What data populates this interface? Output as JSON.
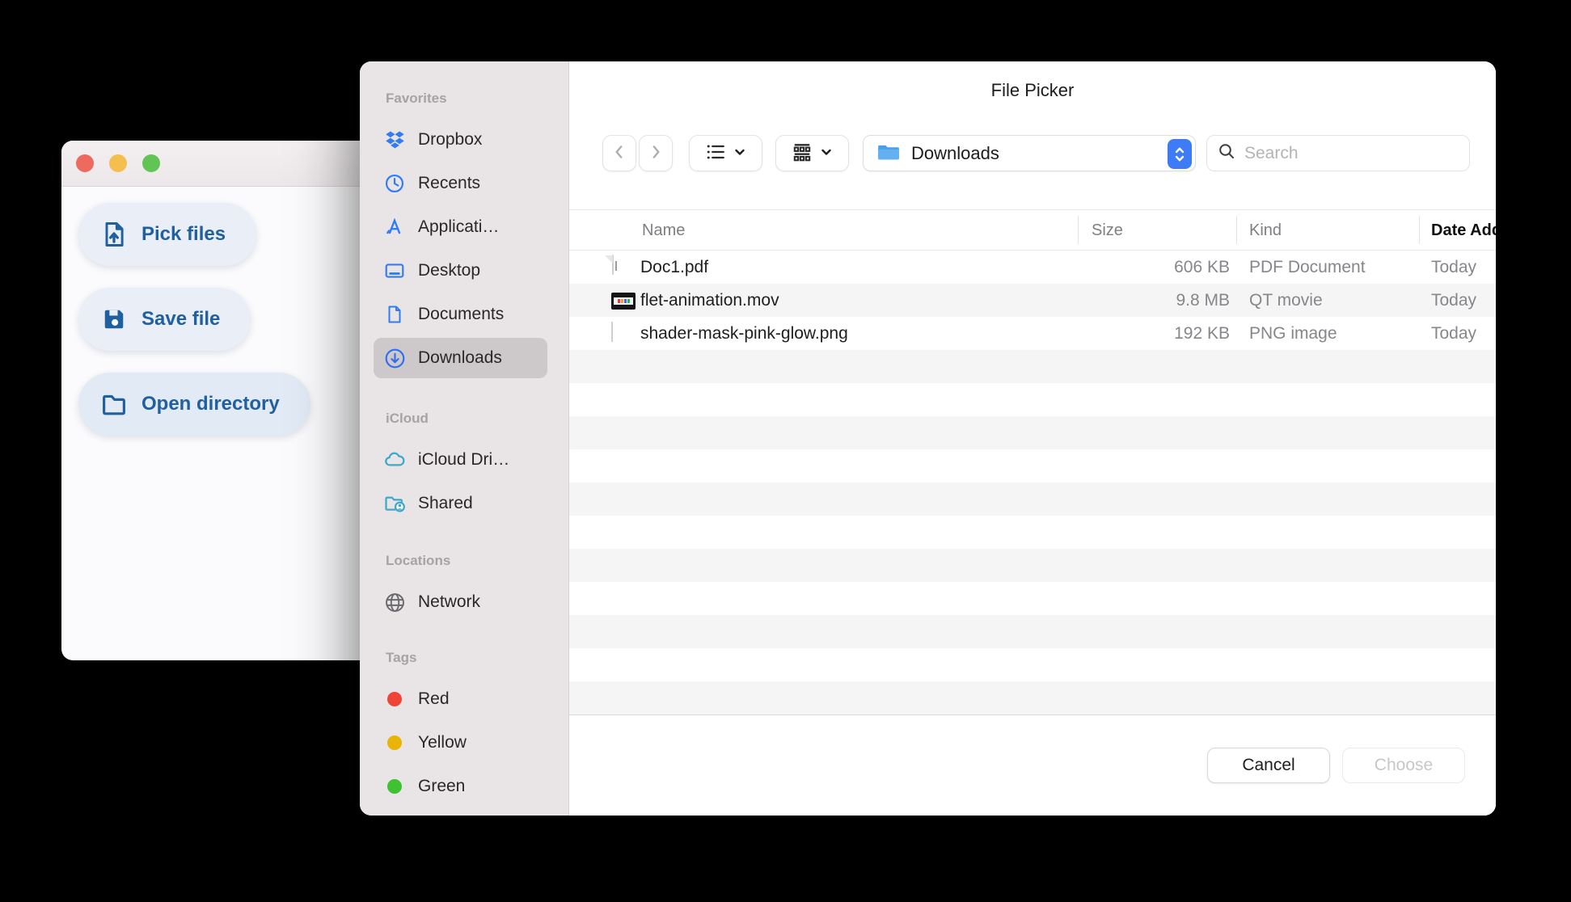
{
  "app_window": {
    "window_controls": [
      "close",
      "minimize",
      "zoom"
    ],
    "buttons": [
      {
        "label": "Pick files",
        "icon": "file-upload-icon"
      },
      {
        "label": "Save file",
        "icon": "save-icon"
      },
      {
        "label": "Open directory",
        "icon": "folder-open-icon"
      }
    ]
  },
  "dialog": {
    "title": "File Picker",
    "sidebar": {
      "sections": [
        {
          "label": "Favorites",
          "items": [
            {
              "label": "Dropbox",
              "icon": "dropbox-icon"
            },
            {
              "label": "Recents",
              "icon": "clock-icon"
            },
            {
              "label": "Applicati…",
              "icon": "app-store-icon"
            },
            {
              "label": "Desktop",
              "icon": "desktop-icon"
            },
            {
              "label": "Documents",
              "icon": "document-icon"
            },
            {
              "label": "Downloads",
              "icon": "download-circle-icon",
              "selected": true
            }
          ]
        },
        {
          "label": "iCloud",
          "items": [
            {
              "label": "iCloud Dri…",
              "icon": "cloud-icon"
            },
            {
              "label": "Shared",
              "icon": "shared-folder-icon"
            }
          ]
        },
        {
          "label": "Locations",
          "items": [
            {
              "label": "Network",
              "icon": "globe-icon"
            }
          ]
        },
        {
          "label": "Tags",
          "items": [
            {
              "label": "Red",
              "color": "#ee4536"
            },
            {
              "label": "Yellow",
              "color": "#eab308"
            },
            {
              "label": "Green",
              "color": "#3ec232"
            }
          ]
        }
      ]
    },
    "toolbar": {
      "path_label": "Downloads",
      "search_placeholder": "Search"
    },
    "table": {
      "columns": [
        "Name",
        "Size",
        "Kind",
        "Date Added"
      ],
      "rows": [
        {
          "name": "Doc1.pdf",
          "size": "606 KB",
          "kind": "PDF Document",
          "date": "Today",
          "icon": "pdf-file-icon"
        },
        {
          "name": "flet-animation.mov",
          "size": "9.8 MB",
          "kind": "QT movie",
          "date": "Today",
          "icon": "movie-file-icon"
        },
        {
          "name": "shader-mask-pink-glow.png",
          "size": "192 KB",
          "kind": "PNG image",
          "date": "Today",
          "icon": "image-file-icon"
        }
      ]
    },
    "footer": {
      "cancel_label": "Cancel",
      "choose_label": "Choose"
    }
  },
  "colors": {
    "accent_blue": "#3d7bf7",
    "app_button_text": "#21609f",
    "sidebar_bg": "#e9e4e6",
    "sidebar_selected": "#cdc8ca",
    "row_stripe": "#f4f5f4",
    "traffic_red": "#ee6a5e",
    "traffic_yellow": "#f4bf4f",
    "traffic_green": "#62c454",
    "icloud_teal": "#3ba8cc",
    "tag_red": "#ee4536",
    "tag_yellow": "#eab308",
    "tag_green": "#3ec232"
  }
}
